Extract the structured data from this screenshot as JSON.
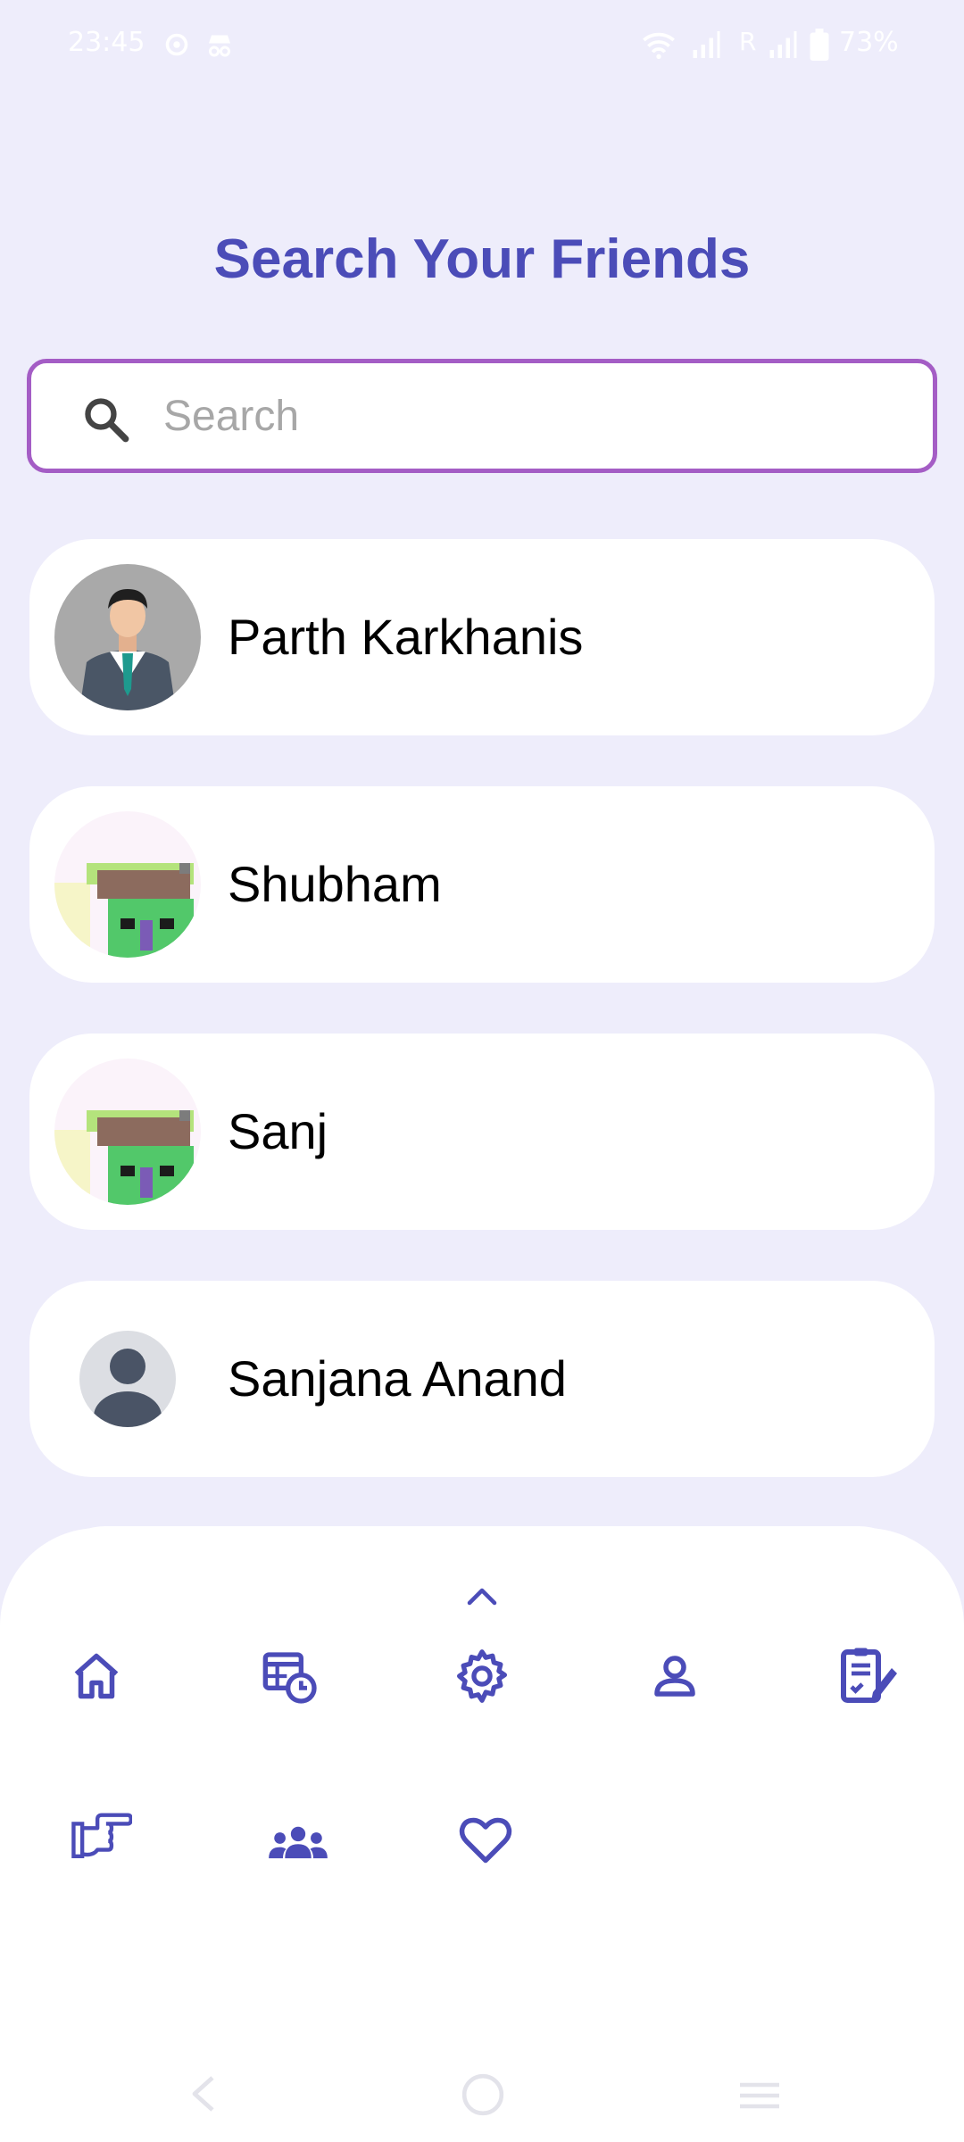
{
  "status_bar": {
    "time": "23:45",
    "battery_percent": "73%",
    "roaming_label": "R",
    "icons": [
      "settings-icon",
      "incognito-icon",
      "wifi-icon",
      "signal-icon",
      "signal-icon",
      "battery-icon"
    ]
  },
  "header": {
    "title": "Search Your Friends"
  },
  "search": {
    "placeholder": "Search",
    "value": ""
  },
  "friends": [
    {
      "name": "Parth Karkhanis",
      "avatar": "businessman-avatar"
    },
    {
      "name": "Shubham",
      "avatar": "pixel-art-avatar"
    },
    {
      "name": "Sanj",
      "avatar": "pixel-art-avatar"
    },
    {
      "name": "Sanjana Anand",
      "avatar": "default-person-avatar"
    }
  ],
  "bottom_menu": {
    "expand_icon": "chevron-up-icon",
    "row1": [
      "home-icon",
      "schedule-icon",
      "settings-icon",
      "profile-icon",
      "notes-icon"
    ],
    "row2": [
      "pointing-hand-icon",
      "group-icon",
      "heart-icon"
    ]
  },
  "system_nav": [
    "back-icon",
    "home-circle-icon",
    "recents-icon"
  ],
  "colors": {
    "background": "#EEEDFB",
    "accent": "#4B4CB8",
    "search_border": "#A45DC5",
    "card": "#FFFFFF"
  }
}
